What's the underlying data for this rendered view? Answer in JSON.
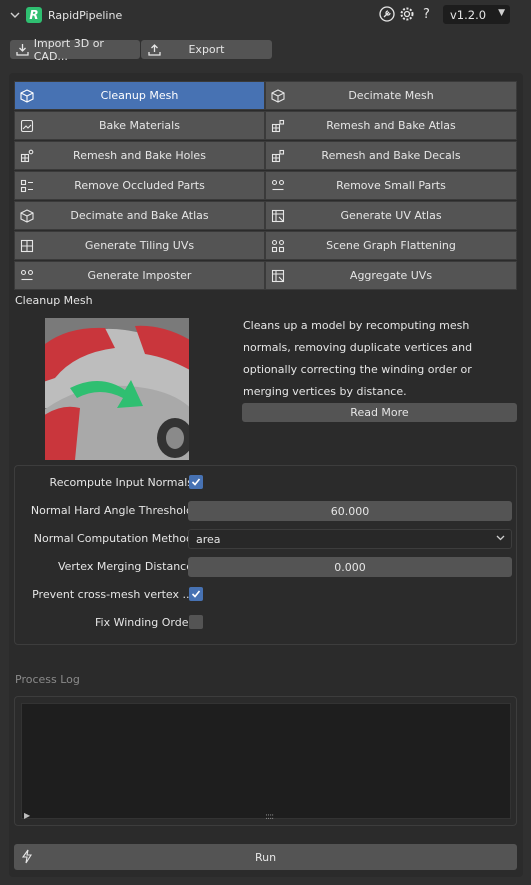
{
  "header": {
    "title": "RapidPipeline",
    "version": "v1.2.0",
    "icons": [
      "wrench-icon",
      "gear-icon",
      "help-icon"
    ],
    "help_glyph": "?"
  },
  "toolbar": {
    "import_label": "Import 3D or CAD...",
    "export_label": "Export"
  },
  "presets": [
    {
      "label": "Cleanup Mesh",
      "icon": "cube-cleanup-icon",
      "active": true
    },
    {
      "label": "Decimate Mesh",
      "icon": "cube-decimate-icon",
      "active": false
    },
    {
      "label": "Bake Materials",
      "icon": "image-bake-icon",
      "active": false
    },
    {
      "label": "Remesh and Bake Atlas",
      "icon": "atlas-grid-icon",
      "active": false
    },
    {
      "label": "Remesh and Bake Holes",
      "icon": "holes-grid-icon",
      "active": false
    },
    {
      "label": "Remesh and Bake Decals",
      "icon": "decals-grid-icon",
      "active": false
    },
    {
      "label": "Remove Occluded Parts",
      "icon": "occluded-parts-icon",
      "active": false
    },
    {
      "label": "Remove Small Parts",
      "icon": "small-parts-icon",
      "active": false
    },
    {
      "label": "Decimate and Bake Atlas",
      "icon": "cube-atlas-icon",
      "active": false
    },
    {
      "label": "Generate UV Atlas",
      "icon": "uv-atlas-icon",
      "active": false
    },
    {
      "label": "Generate Tiling UVs",
      "icon": "tiling-grid-icon",
      "active": false
    },
    {
      "label": "Scene Graph Flattening",
      "icon": "scene-graph-icon",
      "active": false
    },
    {
      "label": "Generate Imposter",
      "icon": "imposter-icon",
      "active": false
    },
    {
      "label": "Aggregate UVs",
      "icon": "aggregate-uv-icon",
      "active": false
    }
  ],
  "selected": {
    "title": "Cleanup Mesh",
    "description": "Cleans up a model by recomputing mesh normals, removing duplicate vertices and optionally correcting the winding order or merging vertices by distance.",
    "read_more_label": "Read More"
  },
  "settings": {
    "recompute_normals": {
      "label": "Recompute Input Normals",
      "checked": true
    },
    "hard_angle": {
      "label": "Normal Hard Angle Threshold",
      "value": "60.000"
    },
    "computation_method": {
      "label": "Normal Computation Method",
      "value": "area"
    },
    "merging_distance": {
      "label": "Vertex Merging Distance",
      "value": "0.000"
    },
    "prevent_cross_mesh": {
      "label": "Prevent cross-mesh vertex ...",
      "checked": true
    },
    "fix_winding": {
      "label": "Fix Winding Order",
      "checked": false
    }
  },
  "log": {
    "title": "Process Log",
    "content": ""
  },
  "run_label": "Run",
  "colors": {
    "accent": "#4772b3",
    "logo": "#2fbf71",
    "button": "#545454",
    "background": "#303030"
  }
}
